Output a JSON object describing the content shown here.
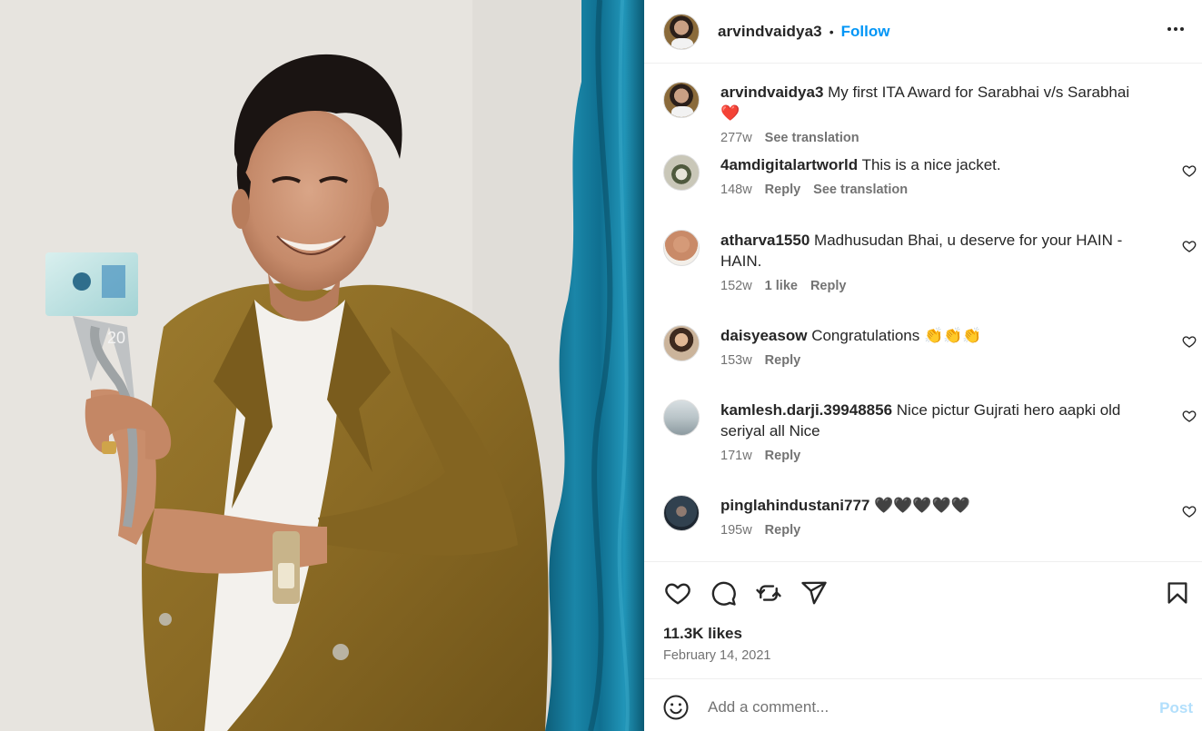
{
  "post": {
    "username": "arvindvaidya3",
    "follow_label": "Follow",
    "separator": "•",
    "more_icon": "more-horizontal-icon"
  },
  "caption": {
    "username": "arvindvaidya3",
    "text": "My first ITA Award for Sarabhai v/s Sarabhai ❤️",
    "age": "277w",
    "see_translation": "See translation"
  },
  "comments": [
    {
      "username": "4amdigitalartworld",
      "text": "This is a nice jacket.",
      "age": "148w",
      "likes": "",
      "reply": "Reply",
      "see_translation": "See translation"
    },
    {
      "username": "atharva1550",
      "text": "Madhusudan Bhai, u deserve for your HAIN - HAIN.",
      "age": "152w",
      "likes": "1 like",
      "reply": "Reply",
      "see_translation": ""
    },
    {
      "username": "daisyeasow",
      "text": "Congratulations 👏👏👏",
      "age": "153w",
      "likes": "",
      "reply": "Reply",
      "see_translation": ""
    },
    {
      "username": "kamlesh.darji.39948856",
      "text": "Nice pictur Gujrati hero aapki old seriyal all Nice",
      "age": "171w",
      "likes": "",
      "reply": "Reply",
      "see_translation": ""
    },
    {
      "username": "pinglahindustani777",
      "text": "🖤🖤🖤🖤🖤",
      "age": "195w",
      "likes": "",
      "reply": "Reply",
      "see_translation": ""
    }
  ],
  "stats": {
    "likes": "11.3K likes",
    "date": "February 14, 2021"
  },
  "composer": {
    "placeholder": "Add a comment...",
    "post_label": "Post"
  },
  "photo": {
    "trophy_text": "20"
  },
  "colors": {
    "accent": "#0095f6",
    "post_disabled": "#b2dffc",
    "muted": "#737373",
    "text": "#262626"
  }
}
